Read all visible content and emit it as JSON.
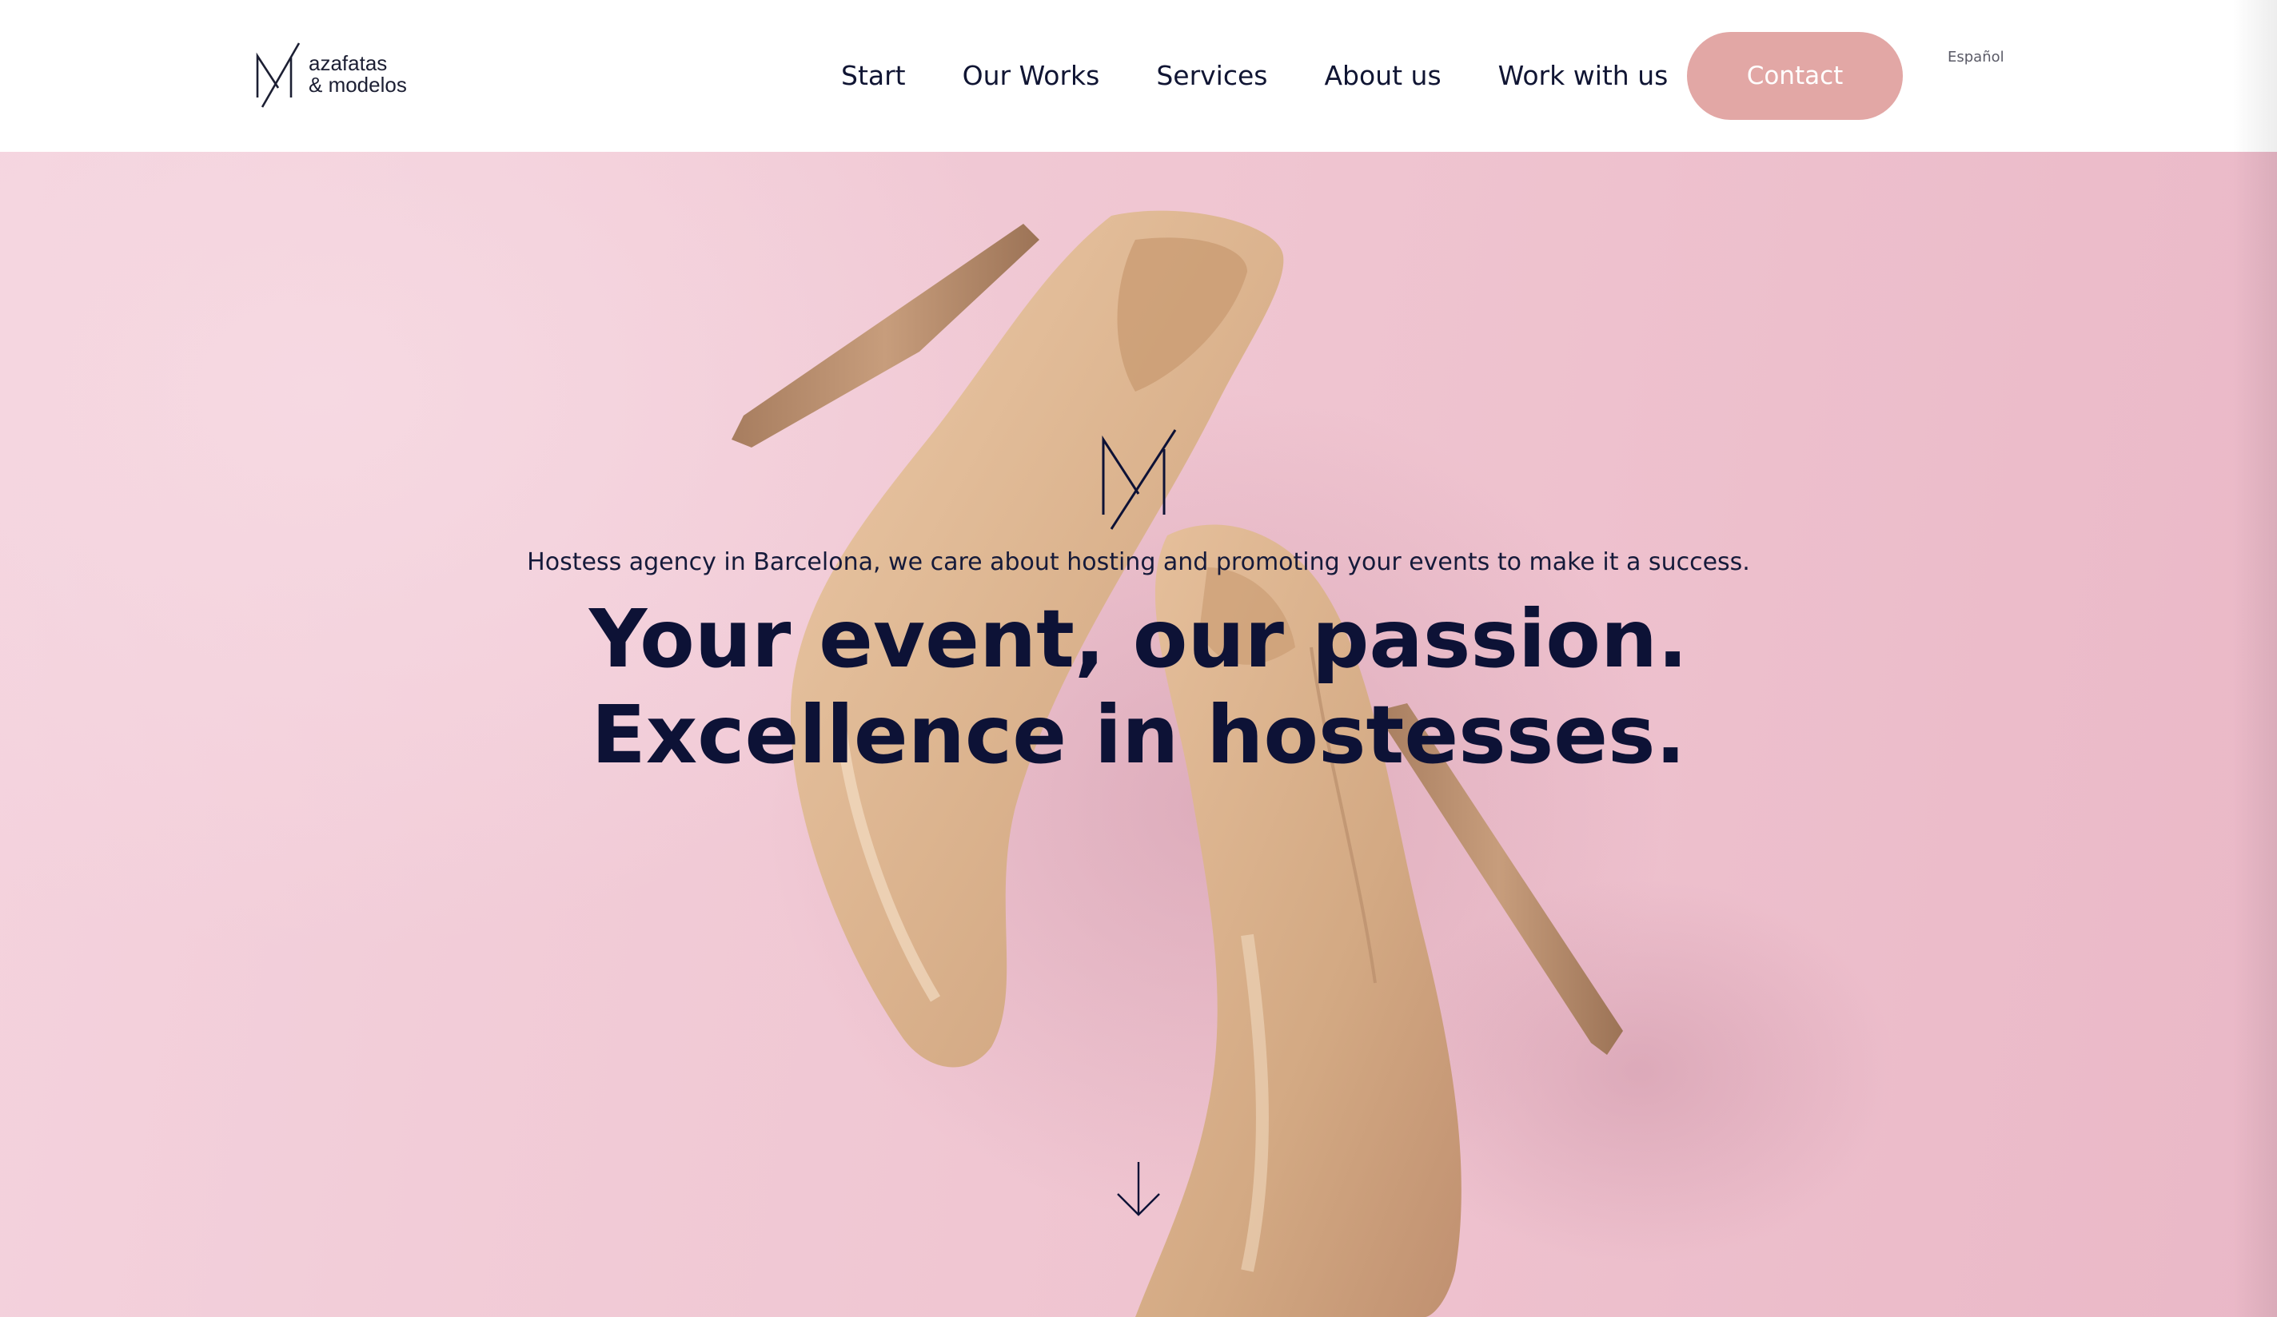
{
  "logo": {
    "line1": "azafatas",
    "line2": "& modelos"
  },
  "nav": {
    "items": [
      {
        "label": "Start"
      },
      {
        "label": "Our Works"
      },
      {
        "label": "Services"
      },
      {
        "label": "About us"
      },
      {
        "label": "Work with us"
      }
    ],
    "contact_label": "Contact",
    "language_label": "Español"
  },
  "hero": {
    "subtitle": "Hostess agency in Barcelona, we care about hosting and promoting your events to make it a success.",
    "title": "Your event, our passion. Excellence in hostesses."
  },
  "icons": {
    "logo_mark": "logo-mark-icon",
    "hero_mark": "brand-mark-icon",
    "scroll": "arrow-down-icon"
  },
  "colors": {
    "accent": "#e2a7a5",
    "text_dark": "#0d1236",
    "hero_background": "#f0c8d3"
  }
}
